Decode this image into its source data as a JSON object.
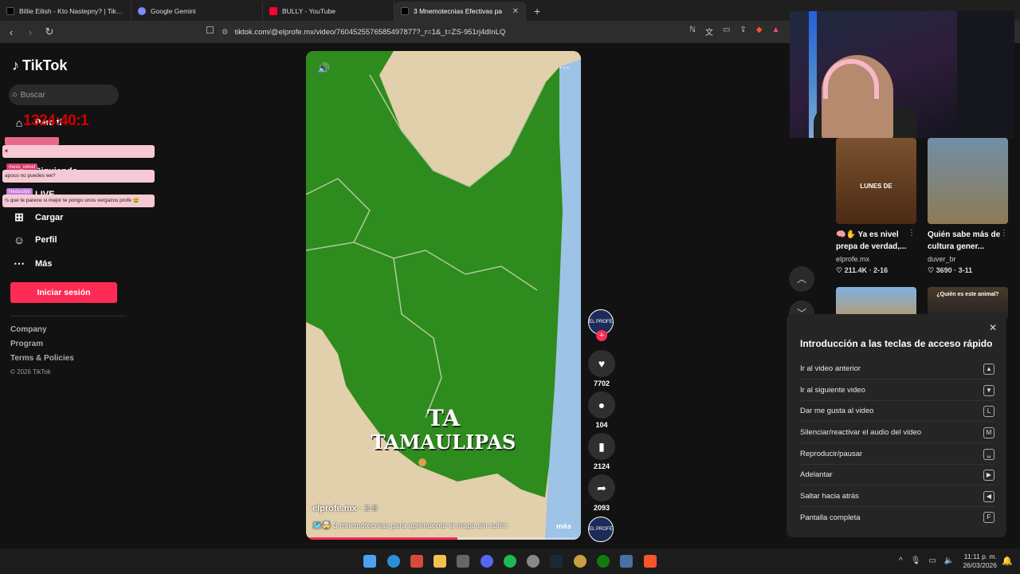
{
  "browser": {
    "tabs": [
      {
        "label": "Billie Eilish - Kto Nastepny? | TikTok",
        "color": "#000000"
      },
      {
        "label": "Google Gemini",
        "color": "#7b8cff"
      },
      {
        "label": "BULLY - YouTube",
        "color": "#ff0033"
      },
      {
        "label": "3 Mnemotecnias Efectivas pa",
        "color": "#000000"
      }
    ],
    "url": "tiktok.com/@elprofe.mx/video/7604525576585497877?_r=1&_t=ZS-951rj4dInLQ"
  },
  "sidebar": {
    "brand": "TikTok",
    "search_placeholder": "Buscar",
    "items": [
      {
        "label": "Para ti",
        "icon": "home-icon"
      },
      {
        "label": "Siguiendo",
        "icon": "following-icon"
      },
      {
        "label": "LIVE",
        "icon": "live-icon"
      },
      {
        "label": "Cargar",
        "icon": "upload-icon"
      },
      {
        "label": "Perfil",
        "icon": "profile-icon"
      },
      {
        "label": "Más",
        "icon": "more-icon"
      }
    ],
    "login": "Iniciar sesión",
    "footer": [
      "Company",
      "Program",
      "Terms & Policies"
    ],
    "copyright": "© 2026 TikTok"
  },
  "overlay": {
    "timer": "1324:40:1",
    "chat": [
      {
        "user": "",
        "text": ""
      },
      {
        "user": "muss_velvet",
        "text": "apoco no puedes we?"
      },
      {
        "user": "Heducdyb",
        "text": "!s que te parece si mejor te pongo unos vergazos profe 🤮"
      }
    ]
  },
  "video": {
    "line1": "TA",
    "line2": "TAMAULIPAS",
    "author": "elprofe.mx",
    "date": "2-8",
    "description": "🗺️🤯 3 mnemotecnias para aprendente el mapa sin sufrir:",
    "more": "más",
    "progress": 0.55,
    "colors": {
      "land": "#2e8b1d",
      "neighbor": "#e2d0ac",
      "sea": "#9dc3e6"
    }
  },
  "actions": {
    "likes": "7702",
    "comments": "104",
    "saves": "2124",
    "shares": "2093",
    "avatar_label": "EL PROFE"
  },
  "suggested": [
    {
      "title": "🧠✋ Ya es nivel prepa de verdad,...",
      "author": "elprofe.mx",
      "stats": "♡ 211.4K · 2-16",
      "thumb_text": "LUNES DE"
    },
    {
      "title": "Quién sabe más de cultura gener...",
      "author": "duver_br",
      "stats": "♡ 3690 · 3-11",
      "thumb_text": ""
    },
    {
      "title": "",
      "author": "",
      "stats": "",
      "thumb_text": ""
    },
    {
      "title": "",
      "author": "",
      "stats": "",
      "thumb_text": "¿Quién es este animal?"
    }
  ],
  "shortcuts": {
    "title": "Introducción a las teclas de acceso rápido",
    "rows": [
      {
        "label": "Ir al video anterior",
        "key": "▲"
      },
      {
        "label": "Ir al siguiente video",
        "key": "▼"
      },
      {
        "label": "Dar me gusta al video",
        "key": "L"
      },
      {
        "label": "Silenciar/reactivar el audio del video",
        "key": "M"
      },
      {
        "label": "Reproducir/pausar",
        "key": "␣"
      },
      {
        "label": "Adelantar",
        "key": "▶"
      },
      {
        "label": "Saltar hacia atrás",
        "key": "◀"
      },
      {
        "label": "Pantalla completa",
        "key": "F"
      }
    ]
  },
  "taskbar": {
    "time": "11:11 p. m.",
    "date": "26/03/2026"
  }
}
